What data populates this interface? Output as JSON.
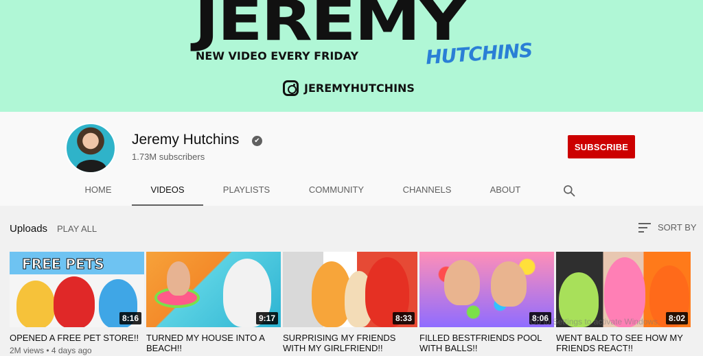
{
  "banner": {
    "title": "JEREMY",
    "tagline": "NEW VIDEO EVERY FRIDAY",
    "script_name": "HUTCHINS",
    "instagram_handle": "JEREMYHUTCHINS"
  },
  "channel": {
    "name": "Jeremy Hutchins",
    "verified_glyph": "✔",
    "subscribers": "1.73M subscribers",
    "subscribe_label": "SUBSCRIBE"
  },
  "tabs": [
    {
      "label": "HOME"
    },
    {
      "label": "VIDEOS"
    },
    {
      "label": "PLAYLISTS"
    },
    {
      "label": "COMMUNITY"
    },
    {
      "label": "CHANNELS"
    },
    {
      "label": "ABOUT"
    }
  ],
  "uploads": {
    "title": "Uploads",
    "play_all": "PLAY ALL",
    "sort_label": "SORT BY"
  },
  "videos": [
    {
      "title": "OPENED A FREE PET STORE!!",
      "duration": "8:16",
      "thumb_text": "FREE PETS",
      "meta": "2M views • 4 days ago"
    },
    {
      "title": "TURNED MY HOUSE INTO A BEACH!!",
      "duration": "9:17"
    },
    {
      "title": "SURPRISING MY FRIENDS WITH MY GIRLFRIEND!!",
      "duration": "8:33"
    },
    {
      "title": "FILLED BESTFRIENDS POOL WITH BALLS!!",
      "duration": "8:06"
    },
    {
      "title": "WENT BALD TO SEE HOW MY FRIENDS REACT!!",
      "duration": "8:02"
    }
  ],
  "overlay": {
    "watermark_text": "Go to Settings to activate Windows."
  },
  "colors": {
    "banner_bg": "#b0f7d6",
    "subscribe_red": "#cc0000",
    "script_blue": "#2a7fd6"
  }
}
